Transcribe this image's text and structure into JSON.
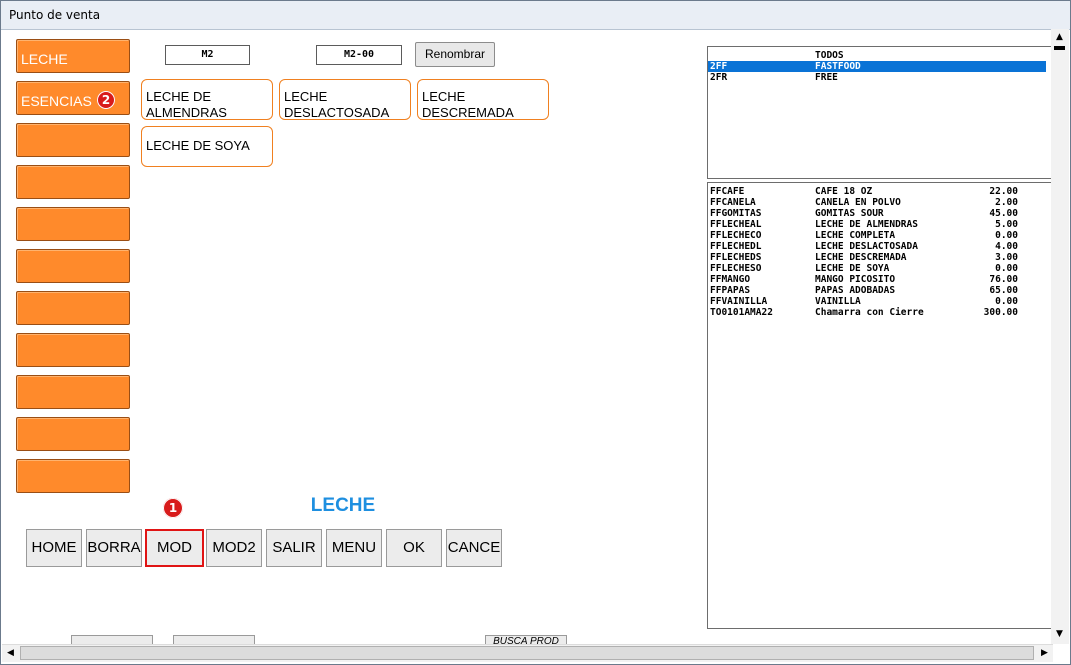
{
  "window": {
    "title": "Punto de venta"
  },
  "categories": [
    {
      "label": "LECHE",
      "badge": ""
    },
    {
      "label": "ESENCIAS",
      "badge": "2"
    },
    {
      "label": "",
      "badge": ""
    },
    {
      "label": "",
      "badge": ""
    },
    {
      "label": "",
      "badge": ""
    },
    {
      "label": "",
      "badge": ""
    },
    {
      "label": "",
      "badge": ""
    },
    {
      "label": "",
      "badge": ""
    },
    {
      "label": "",
      "badge": ""
    },
    {
      "label": "",
      "badge": ""
    },
    {
      "label": "",
      "badge": ""
    }
  ],
  "header": {
    "code1": "M2",
    "code2": "M2-00",
    "rename_label": "Renombrar"
  },
  "products": [
    {
      "label": "LECHE DE ALMENDRAS"
    },
    {
      "label": "LECHE DESLACTOSADA"
    },
    {
      "label": "LECHE DESCREMADA"
    },
    {
      "label": "LECHE DE SOYA"
    }
  ],
  "group_label": "LECHE",
  "action_badge": "1",
  "actions": [
    "HOME",
    "BORRA",
    "MOD",
    "MOD2",
    "SALIR",
    "MENU",
    "OK",
    "CANCE"
  ],
  "groups_list": [
    {
      "code": "",
      "name": "TODOS",
      "selected": false
    },
    {
      "code": "2FF",
      "name": "FASTFOOD",
      "selected": true
    },
    {
      "code": "2FR",
      "name": "FREE",
      "selected": false
    }
  ],
  "products_list": [
    {
      "code": "FFCAFE",
      "name": "CAFE 18 OZ",
      "price": "22.00"
    },
    {
      "code": "FFCANELA",
      "name": "CANELA EN POLVO",
      "price": "2.00"
    },
    {
      "code": "FFGOMITAS",
      "name": "GOMITAS SOUR",
      "price": "45.00"
    },
    {
      "code": "FFLECHEAL",
      "name": "LECHE DE ALMENDRAS",
      "price": "5.00"
    },
    {
      "code": "FFLECHECO",
      "name": "LECHE COMPLETA",
      "price": "0.00"
    },
    {
      "code": "FFLECHEDL",
      "name": "LECHE DESLACTOSADA",
      "price": "4.00"
    },
    {
      "code": "FFLECHEDS",
      "name": "LECHE DESCREMADA",
      "price": "3.00"
    },
    {
      "code": "FFLECHESO",
      "name": "LECHE DE SOYA",
      "price": "0.00"
    },
    {
      "code": "FFMANGO",
      "name": "MANGO PICOSITO",
      "price": "76.00"
    },
    {
      "code": "FFPAPAS",
      "name": "PAPAS ADOBADAS",
      "price": "65.00"
    },
    {
      "code": "FFVAINILLA",
      "name": "VAINILLA",
      "price": "0.00"
    },
    {
      "code": "TO0101AMA22",
      "name": "Chamarra con Cierre",
      "price": "300.00"
    }
  ],
  "bottom": {
    "search_label": "BUSCA PROD"
  },
  "icons": {
    "scroll_up": "up-arrow-icon",
    "scroll_down": "down-arrow-icon",
    "scroll_left": "left-arrow-icon",
    "scroll_right": "right-arrow-icon"
  },
  "colors": {
    "category_fill": "#ff8a2b",
    "product_border": "#f08020",
    "group_label": "#1e8fe0",
    "selection": "#0a73d6",
    "badge": "#d81b1b",
    "highlight": "#e01414"
  }
}
